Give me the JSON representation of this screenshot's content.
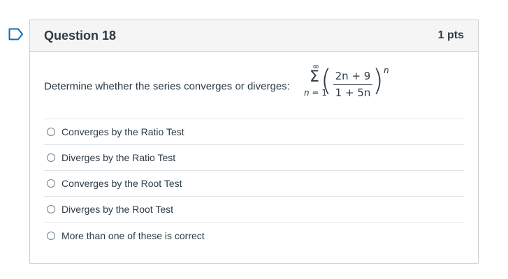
{
  "question": {
    "title": "Question 18",
    "points": "1 pts",
    "prompt": "Determine whether the series converges or diverges:",
    "formula": {
      "upper_limit": "∞",
      "sigma": "Σ",
      "lower_limit_var": "n",
      "lower_limit_rest": " = 1",
      "numerator": "2n + 9",
      "denominator": "1 + 5n",
      "exponent": "n"
    },
    "answers": [
      "Converges by the Ratio Test",
      "Diverges by the Ratio Test",
      "Converges by the Root Test",
      "Diverges by the Root Test",
      "More than one of these is correct"
    ]
  },
  "colors": {
    "flag": "#0b6fb8",
    "header_bg": "#f5f5f5",
    "border": "#c7cdd1",
    "text": "#2d3b45"
  },
  "icons": {
    "flag": "bookmark-flag-icon",
    "radio": "radio-unchecked-icon"
  }
}
